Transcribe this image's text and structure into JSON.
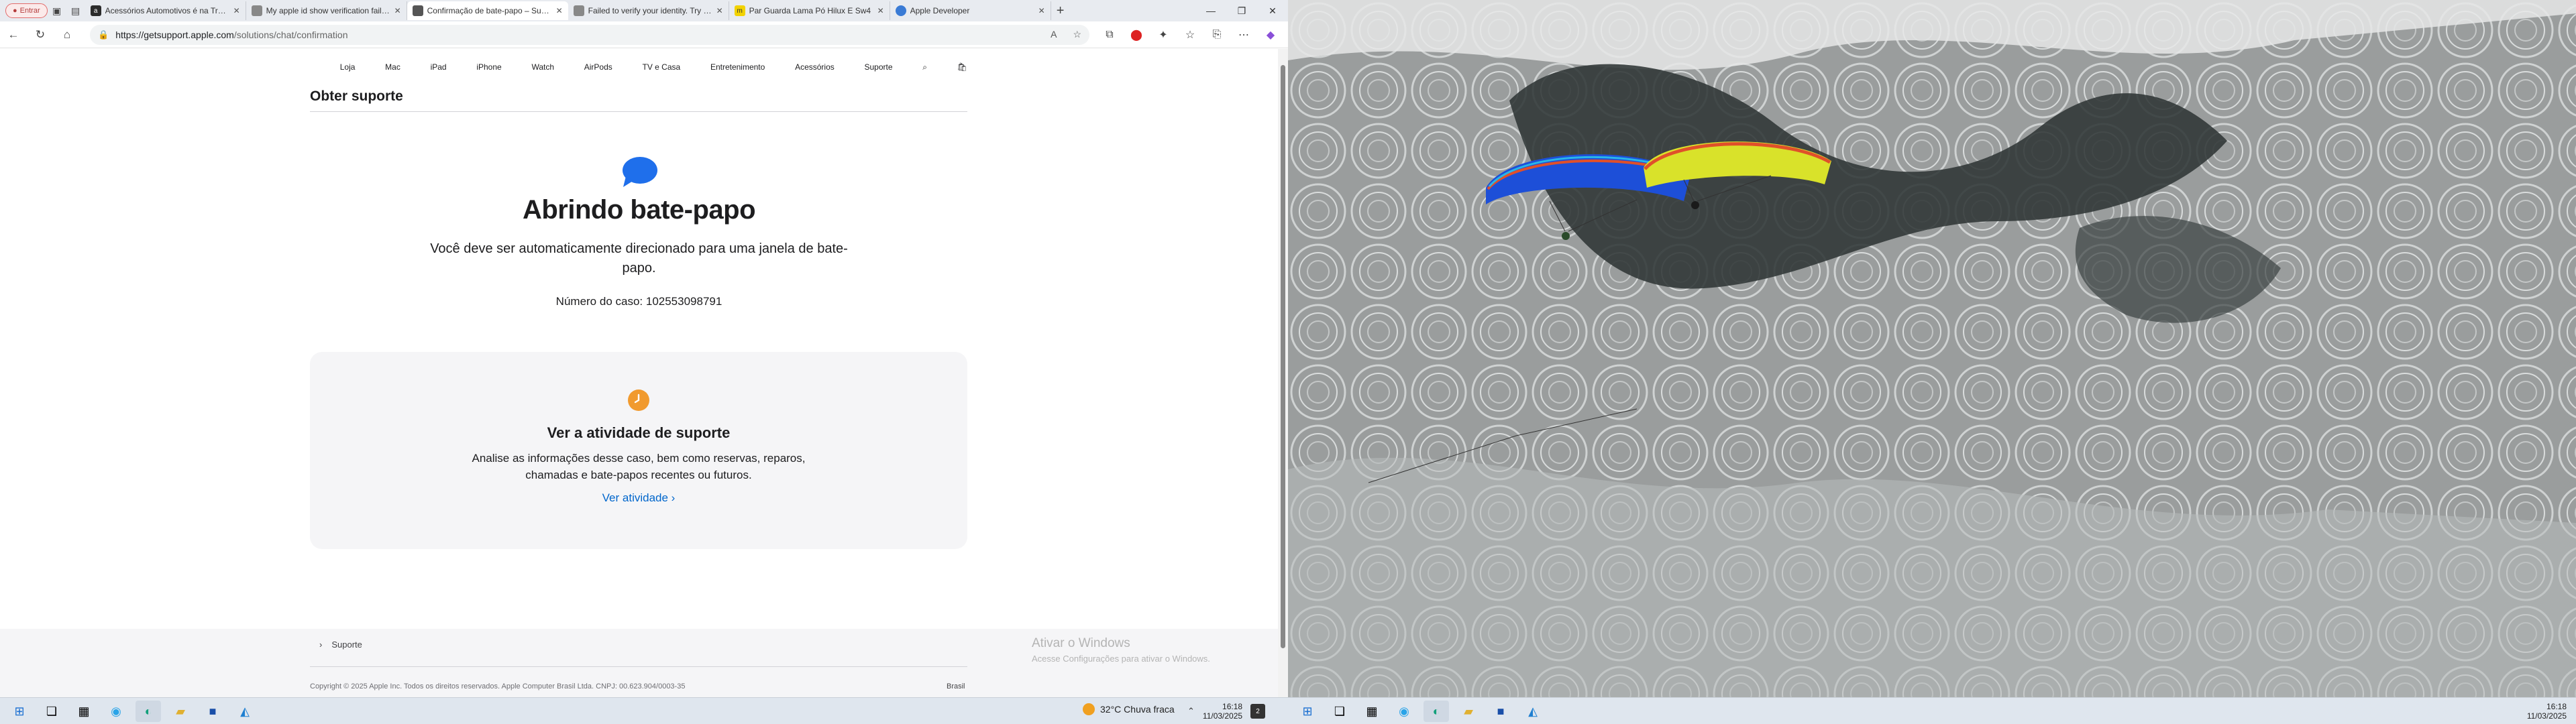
{
  "browser": {
    "profile_label": "Entrar",
    "tabs": [
      {
        "title": "Acessórios Automotivos é na Troca",
        "fav": "a",
        "color": "#2b2b2b"
      },
      {
        "title": "My apple id show verification failed",
        "fav": "",
        "color": "#888888"
      },
      {
        "title": "Confirmação de bate-papo – Suporte",
        "fav": "",
        "color": "#555555",
        "active": true
      },
      {
        "title": "Failed to verify your identity. Try again",
        "fav": "",
        "color": "#888888"
      },
      {
        "title": "Par Guarda Lama Pó Hilux E Sw4",
        "fav": "m",
        "color": "#f2d200"
      },
      {
        "title": "Apple Developer",
        "fav": "",
        "color": "#3a7bd5"
      }
    ],
    "url_host": "https://getsupport.apple.com",
    "url_path": "/solutions/chat/confirmation"
  },
  "apple_nav": {
    "items": [
      "Loja",
      "Mac",
      "iPad",
      "iPhone",
      "Watch",
      "AirPods",
      "TV e Casa",
      "Entretenimento",
      "Acessórios",
      "Suporte"
    ]
  },
  "page": {
    "subnav_title": "Obter suporte",
    "heading": "Abrindo bate-papo",
    "description": "Você deve ser automaticamente direcionado para uma janela de bate-papo.",
    "case_label": "Número do caso:",
    "case_number": "102553098791",
    "card_title": "Ver a atividade de suporte",
    "card_text": "Analise as informações desse caso, bem como reservas, reparos, chamadas e bate-papos recentes ou futuros.",
    "card_link": "Ver atividade ›",
    "footer_breadcrumb": "Suporte",
    "copyright": "Copyright © 2025 Apple Inc. Todos os direitos reservados. Apple Computer Brasil Ltda. CNPJ: 00.623.904/0003-35",
    "country": "Brasil",
    "accent_blue": "#0066cc",
    "bubble_color": "#1f6feb",
    "clock_color": "#f19a2e"
  },
  "watermark": {
    "title": "Ativar o Windows",
    "subtitle": "Acesse Configurações para ativar o Windows."
  },
  "taskbar": {
    "weather": "32°C  Chuva fraca",
    "time": "16:18",
    "date": "11/03/2025",
    "notif_count": "2"
  },
  "wallpaper": {
    "description_colors": [
      "#8e9292",
      "#2f3636",
      "#e6e8e8"
    ],
    "glider1_color": "#1d4fd8",
    "glider2_color": "#d9e22a"
  }
}
